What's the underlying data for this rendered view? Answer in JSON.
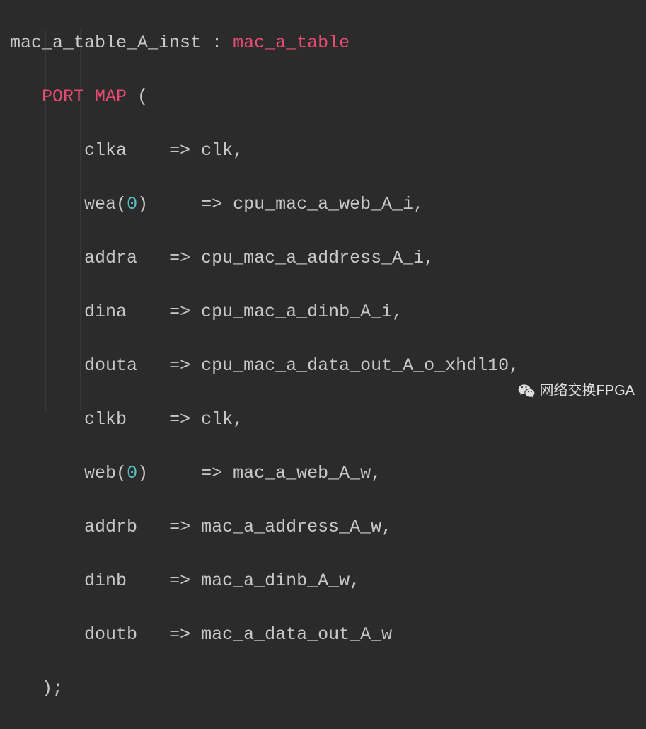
{
  "code": {
    "instance_name": "mac_a_table_A_inst",
    "colon": " : ",
    "type_name": "mac_a_table",
    "port_map_kw": "PORT MAP",
    "open_paren": " (",
    "close": ");",
    "arrow": "=>",
    "ports": [
      {
        "formal": "clka",
        "idx": "",
        "actual": "clk",
        "comma": ","
      },
      {
        "formal": "wea",
        "idx": "0",
        "actual": "cpu_mac_a_web_A_i",
        "comma": ","
      },
      {
        "formal": "addra",
        "idx": "",
        "actual": "cpu_mac_a_address_A_i",
        "comma": ","
      },
      {
        "formal": "dina",
        "idx": "",
        "actual": "cpu_mac_a_dinb_A_i",
        "comma": ","
      },
      {
        "formal": "douta",
        "idx": "",
        "actual": "cpu_mac_a_data_out_A_o_xhdl10",
        "comma": ","
      },
      {
        "formal": "clkb",
        "idx": "",
        "actual": "clk",
        "comma": ","
      },
      {
        "formal": "web",
        "idx": "0",
        "actual": "mac_a_web_A_w",
        "comma": ","
      },
      {
        "formal": "addrb",
        "idx": "",
        "actual": "mac_a_address_A_w",
        "comma": ","
      },
      {
        "formal": "dinb",
        "idx": "",
        "actual": "mac_a_dinb_A_w",
        "comma": ","
      },
      {
        "formal": "doutb",
        "idx": "",
        "actual": "mac_a_data_out_A_w",
        "comma": ""
      }
    ]
  },
  "watermark": {
    "text": "网络交换FPGA"
  },
  "colors": {
    "bg": "#2b2b2b",
    "fg": "#c8c8c8",
    "keyword": "#e84a72",
    "number": "#5abfc0"
  }
}
